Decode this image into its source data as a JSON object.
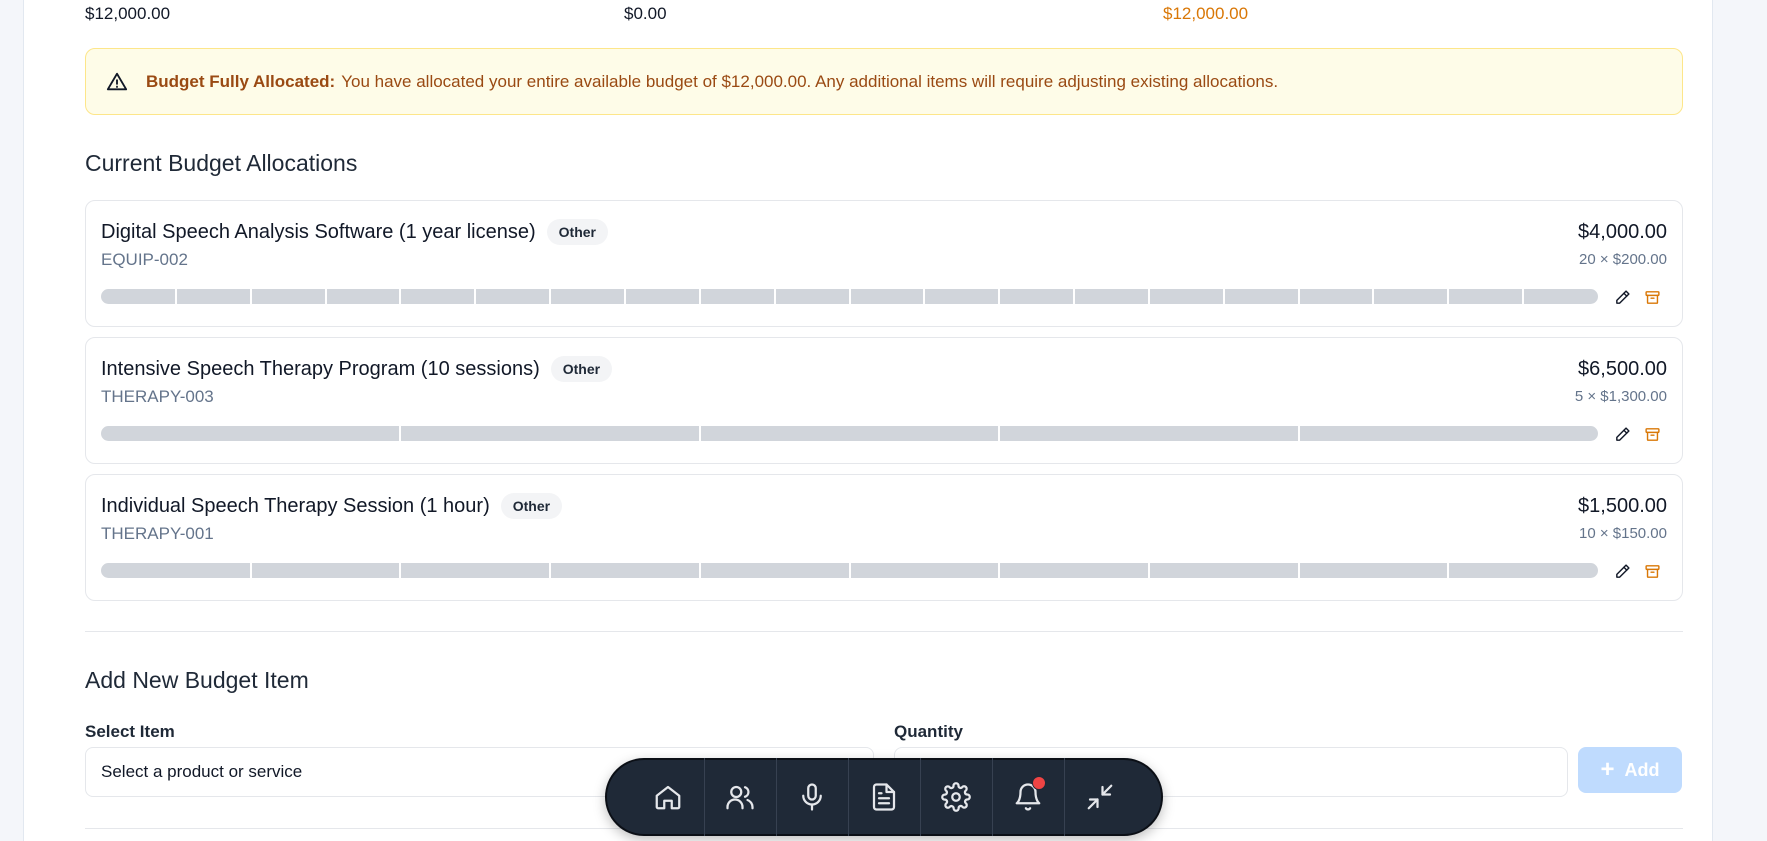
{
  "totals": {
    "total": "$12,000.00",
    "remaining": "$0.00",
    "allocated": "$12,000.00"
  },
  "alert": {
    "title": "Budget Fully Allocated:",
    "message": "You have allocated your entire available budget of $12,000.00. Any additional items will require adjusting existing allocations."
  },
  "allocations_heading": "Current Budget Allocations",
  "items": [
    {
      "name": "Digital Speech Analysis Software (1 year license)",
      "category": "Other",
      "code": "EQUIP-002",
      "amount": "$4,000.00",
      "calc": "20 × $200.00",
      "quantity": 20
    },
    {
      "name": "Intensive Speech Therapy Program (10 sessions)",
      "category": "Other",
      "code": "THERAPY-003",
      "amount": "$6,500.00",
      "calc": "5 × $1,300.00",
      "quantity": 5
    },
    {
      "name": "Individual Speech Therapy Session (1 hour)",
      "category": "Other",
      "code": "THERAPY-001",
      "amount": "$1,500.00",
      "calc": "10 × $150.00",
      "quantity": 10
    }
  ],
  "add_form": {
    "heading": "Add New Budget Item",
    "select_label": "Select Item",
    "select_placeholder": "Select a product or service",
    "quantity_label": "Quantity",
    "add_label": "Add"
  },
  "dock": [
    "home-icon",
    "users-icon",
    "microphone-icon",
    "document-icon",
    "settings-icon",
    "bell-icon",
    "minimize-icon"
  ],
  "colors": {
    "allocated": "#d97706",
    "alert_text": "#9a4a13",
    "add_button": "#bfdbfe",
    "dock_bg": "#1f2937",
    "notification_dot": "#ef4444"
  }
}
